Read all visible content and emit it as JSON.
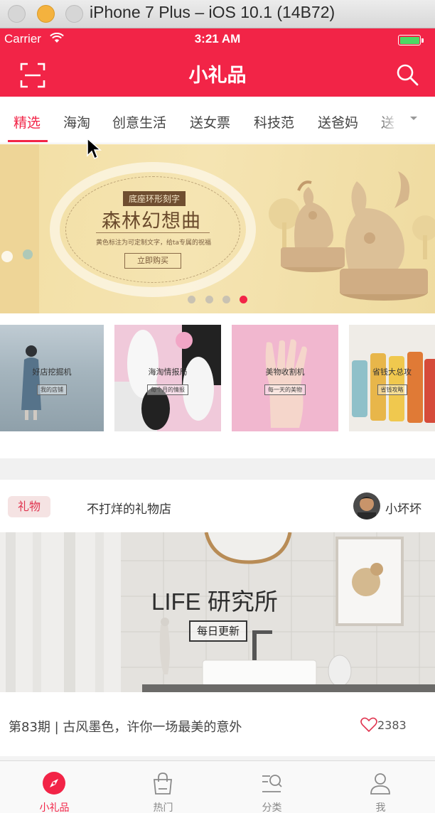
{
  "window": {
    "title": "iPhone 7 Plus – iOS 10.1 (14B72)"
  },
  "status_bar": {
    "carrier": "Carrier",
    "time": "3:21 AM",
    "battery_color": "#4cd964"
  },
  "nav": {
    "title": "小礼品",
    "left_icon": "scan-icon",
    "right_icon": "search-icon",
    "color": "#f22447"
  },
  "channels": {
    "tabs": [
      {
        "label": "精选",
        "active": true
      },
      {
        "label": "海淘"
      },
      {
        "label": "创意生活"
      },
      {
        "label": "送女票"
      },
      {
        "label": "科技范"
      },
      {
        "label": "送爸妈"
      },
      {
        "label": "送"
      }
    ],
    "more_icon": "chevron-down-icon"
  },
  "banner": {
    "tag": "底座环形刻字",
    "headline": "森林幻想曲",
    "subline": "黄色标注为可定制文字，给ta专属的祝福",
    "button": "立即购买",
    "page_count": 4,
    "active_page": 4
  },
  "cards": [
    {
      "label": "好店挖掘机",
      "sub": "我的店铺",
      "bg": "#9aa9b3"
    },
    {
      "label": "海淘情报局",
      "sub": "每个月的情报",
      "bg": "#f2c4d6"
    },
    {
      "label": "美物收割机",
      "sub": "每一天的美物",
      "bg": "#f1b8cf"
    },
    {
      "label": "省钱大总攻",
      "sub": "省钱攻略",
      "bg": "#e7e4df"
    }
  ],
  "feed": {
    "tag": "礼物",
    "shop": "不打烊的礼物店",
    "author": "小坏坏",
    "image_headline": "LIFE 研究所",
    "image_button": "每日更新",
    "title": "第83期 | 古风墨色，许你一场最美的意外",
    "likes": "2383"
  },
  "tabbar": {
    "items": [
      {
        "label": "小礼品",
        "icon": "compass-icon",
        "active": true
      },
      {
        "label": "热门",
        "icon": "bag-icon"
      },
      {
        "label": "分类",
        "icon": "category-search-icon"
      },
      {
        "label": "我",
        "icon": "person-icon"
      }
    ],
    "active_color": "#f22447"
  }
}
